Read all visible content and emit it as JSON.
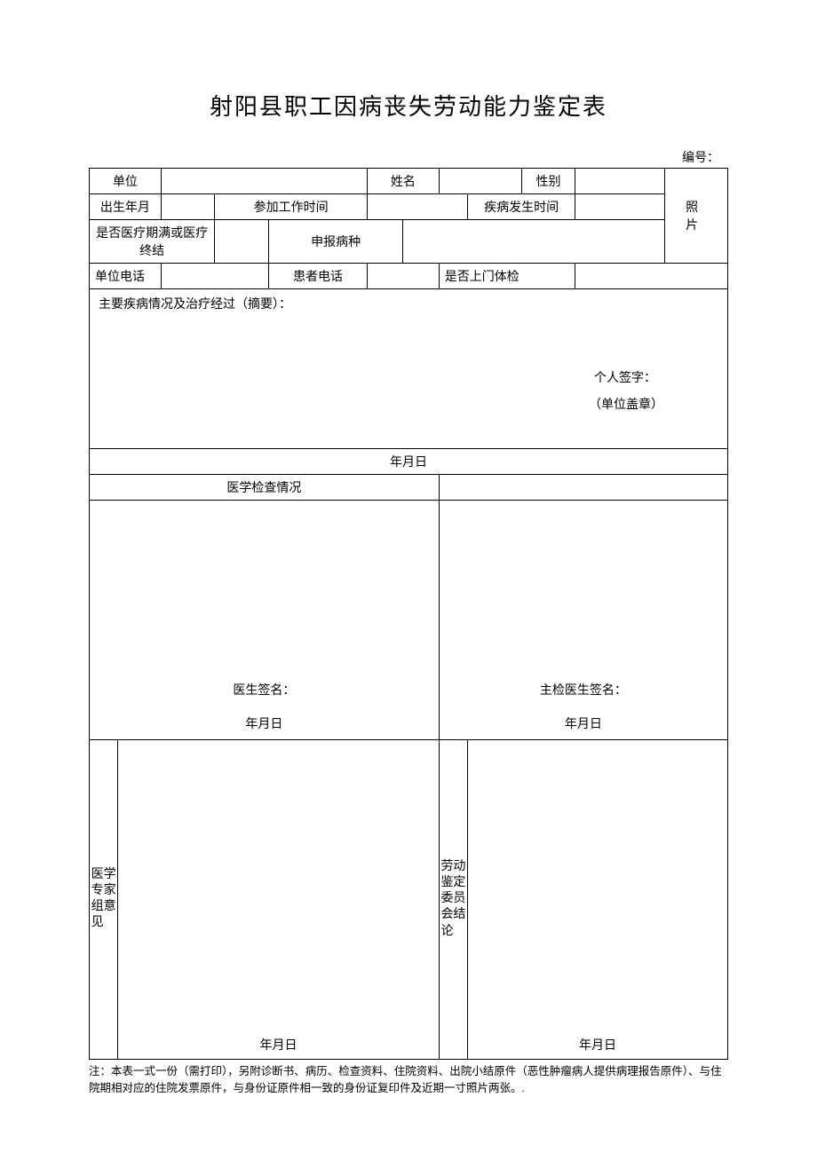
{
  "title": "射阳县职工因病丧失劳动能力鉴定表",
  "serial_label": "编号：",
  "labels": {
    "unit": "单位",
    "name": "姓名",
    "gender": "性别",
    "birth": "出生年月",
    "join_work": "参加工作时间",
    "disease_time": "疾病发生时间",
    "medical_end": "是否医疗期满或医疗终结",
    "disease_type": "申报病种",
    "unit_phone": "单位电话",
    "patient_phone": "患者电话",
    "home_check": "是否上门体检",
    "photo": "照 片",
    "summary": "主要疾病情况及治疗经过（摘要）：",
    "personal_sign": "个人签字：",
    "unit_stamp": "（单位盖章）",
    "ymd": "年月日",
    "med_check": "医学检查情况",
    "doctor_sign": "医生签名：",
    "chief_doctor_sign": "主检医生签名：",
    "expert_opinion": "医学专家组意见",
    "committee": "劳动鉴定委员会结论"
  },
  "values": {
    "unit": "",
    "name": "",
    "gender": "",
    "birth": "",
    "join_work": "",
    "disease_time": "",
    "medical_end": "",
    "disease_type": "",
    "unit_phone": "",
    "patient_phone": "",
    "home_check": ""
  },
  "note": "注：本表一式一份（需打印），另附诊断书、病历、检查资料、住院资料、出院小结原件（恶性肿瘤病人提供病理报告原件）、与住院期相对应的住院发票原件，与身份证原件相一致的身份证复印件及近期一寸照片两张。."
}
